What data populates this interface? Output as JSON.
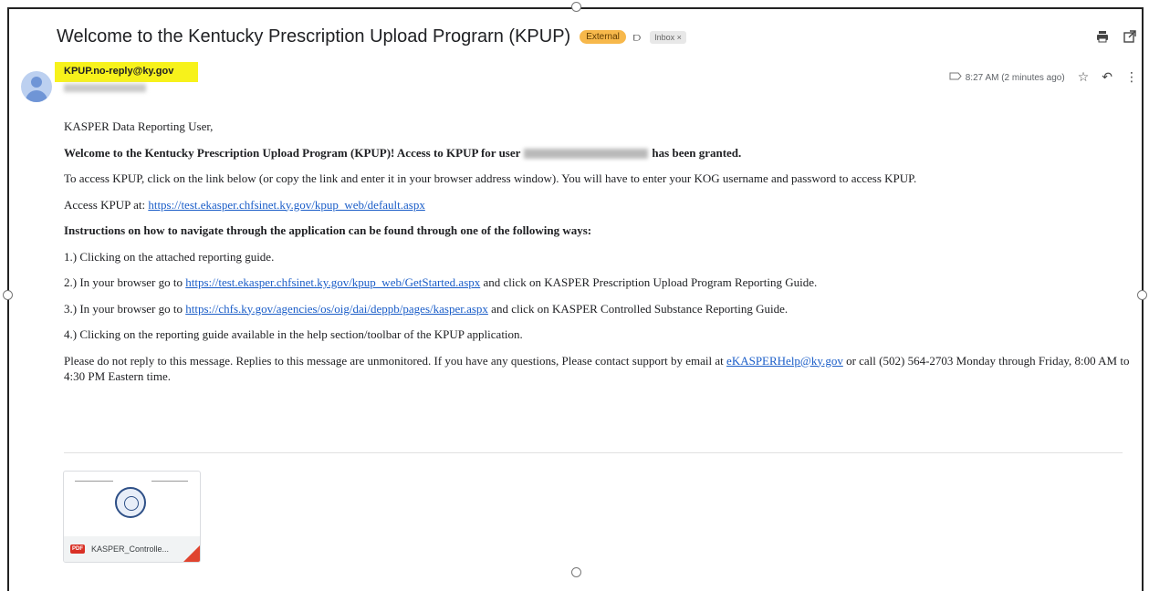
{
  "email": {
    "subject": "Welcome to the Kentucky Prescription Upload Prograrn (KPUP)",
    "labels": {
      "external": "External",
      "inbox": "Inbox ×"
    },
    "sender": "KPUP.no-reply@ky.gov",
    "time": "8:27 AM (2 minutes ago)"
  },
  "icons": {
    "print": "print-icon",
    "popout": "open-in-new-window-icon",
    "star": "star-icon",
    "reply": "reply-icon",
    "more": "more-vertical-icon",
    "important": "importance-marker-icon",
    "label": "label-icon"
  },
  "body": {
    "greeting": "KASPER Data Reporting User,",
    "welcome_a": "Welcome to the Kentucky Prescription Upload Program (KPUP)! Access to KPUP for user",
    "welcome_b": "has been granted.",
    "access_info": "To access KPUP, click on the link below (or copy the link and enter it in your browser address window). You will have to enter your KOG username and password to access KPUP.",
    "access_label": "Access KPUP at:",
    "access_link": "https://test.ekasper.chfsinet.ky.gov/kpup_web/default.aspx",
    "instructions_heading": "Instructions on how to navigate through the application can be found through one of the following ways:",
    "step1": "1.) Clicking on the attached reporting guide.",
    "step2_pre": "2.) In your browser go to",
    "step2_link": "https://test.ekasper.chfsinet.ky.gov/kpup_web/GetStarted.aspx",
    "step2_post": "and click on KASPER Prescription Upload Program Reporting Guide.",
    "step3_pre": "3.) In your browser go to",
    "step3_link": "https://chfs.ky.gov/agencies/os/oig/dai/deppb/pages/kasper.aspx",
    "step3_post": "and click on KASPER Controlled Substance Reporting Guide.",
    "step4": "4.) Clicking on the reporting guide available in the help section/toolbar of the KPUP application.",
    "footer_pre": "Please do not reply to this message. Replies to this message are unmonitored. If you have any questions, Please contact support by email at",
    "footer_link": "eKASPERHelp@ky.gov",
    "footer_post": "or call (502) 564-2703 Monday through Friday, 8:00 AM to 4:30 PM Eastern time."
  },
  "attachment": {
    "type": "PDF",
    "name": "KASPER_Controlle..."
  },
  "colors": {
    "external_badge": "#f7b84b",
    "highlight": "#f7f21b",
    "link": "#1a5dc8",
    "pdf": "#d93025"
  }
}
